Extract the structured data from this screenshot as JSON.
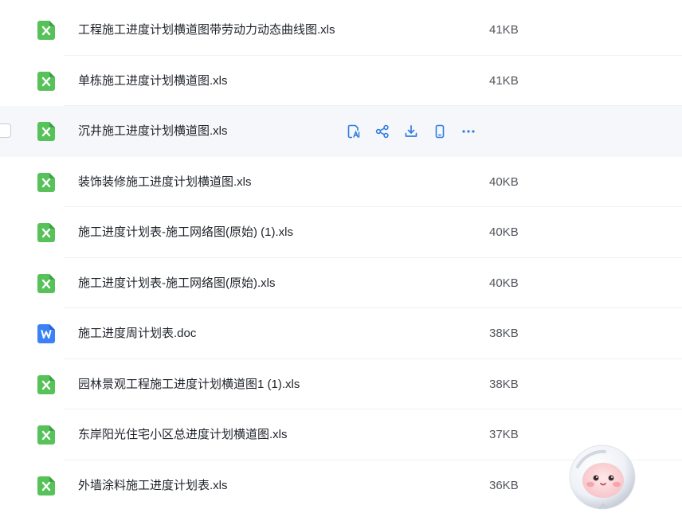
{
  "colors": {
    "excel": "#2ea043",
    "excel_bg": "#57c25a",
    "word": "#3b82f6",
    "action": "#2f7de1"
  },
  "files": [
    {
      "name": "工程施工进度计划横道图带劳动力动态曲线图.xls",
      "size": "41KB",
      "type": "excel"
    },
    {
      "name": "单栋施工进度计划横道图.xls",
      "size": "41KB",
      "type": "excel"
    },
    {
      "name": "沉井施工进度计划横道图.xls",
      "size": "",
      "type": "excel",
      "hover": true
    },
    {
      "name": "装饰装修施工进度计划横道图.xls",
      "size": "40KB",
      "type": "excel"
    },
    {
      "name": "施工进度计划表-施工网络图(原始) (1).xls",
      "size": "40KB",
      "type": "excel"
    },
    {
      "name": "施工进度计划表-施工网络图(原始).xls",
      "size": "40KB",
      "type": "excel"
    },
    {
      "name": "施工进度周计划表.doc",
      "size": "38KB",
      "type": "word"
    },
    {
      "name": "园林景观工程施工进度计划横道图1 (1).xls",
      "size": "38KB",
      "type": "excel"
    },
    {
      "name": "东岸阳光住宅小区总进度计划横道图.xls",
      "size": "37KB",
      "type": "excel"
    },
    {
      "name": "外墙涂料施工进度计划表.xls",
      "size": "36KB",
      "type": "excel"
    }
  ],
  "row_actions": [
    "preview-icon",
    "share-icon",
    "download-icon",
    "send-to-phone-icon",
    "more-icon"
  ]
}
